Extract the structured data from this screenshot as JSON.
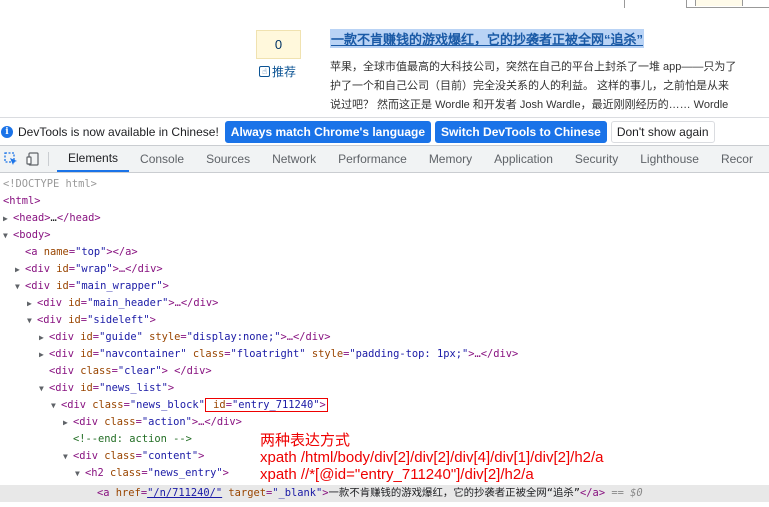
{
  "page": {
    "vote_count": "0",
    "recommend_label": "推荐",
    "news_title": "一款不肯赚钱的游戏爆红，它的抄袭者正被全网“追杀”",
    "summary_lines": [
      "苹果，全球市值最高的大科技公司，突然在自己的平台上封杀了一堆 app——只为了",
      "护了一个和自己公司（目前）完全没关系的人的利益。 这样的事儿，之前怕是从来",
      "说过吧？ 然而这正是 Wordle 和开发者 Josh Wardle，最近刚刚经历的…… Wordle"
    ]
  },
  "infobar": {
    "icon": "info-icon",
    "message": "DevTools is now available in Chinese!",
    "btn_match": "Always match Chrome's language",
    "btn_switch": "Switch DevTools to Chinese",
    "btn_dismiss": "Don't show again"
  },
  "toolbar": {
    "tabs": [
      "Elements",
      "Console",
      "Sources",
      "Network",
      "Performance",
      "Memory",
      "Application",
      "Security",
      "Lighthouse",
      "Recor"
    ],
    "active_tab": "Elements"
  },
  "dom": {
    "l0": "<!DOCTYPE html>",
    "l1_tag": "<html>",
    "l2_open": "<head>",
    "l2_ell": "…",
    "l2_close": "</head>",
    "l3_tag": "<body>",
    "l4_tag": "<a ",
    "l4_attr": "name",
    "l4_val": "\"top\"",
    "l4_end": "></a>",
    "l5_tag": "<div ",
    "l5_attr": "id",
    "l5_val": "\"wrap\"",
    "l5_end": ">…</div>",
    "l6_tag": "<div ",
    "l6_attr": "id",
    "l6_val": "\"main_wrapper\"",
    "l6_end": ">",
    "l7_tag": "<div ",
    "l7_attr": "id",
    "l7_val": "\"main_header\"",
    "l7_end": ">…</div>",
    "l8_tag": "<div ",
    "l8_attr": "id",
    "l8_val": "\"sideleft\"",
    "l8_end": ">",
    "l9_tag": "<div ",
    "l9_attr1": "id",
    "l9_val1": "\"guide\"",
    "l9_attr2": "style",
    "l9_val2": "\"display:none;\"",
    "l9_end": ">…</div>",
    "l10_tag": "<div ",
    "l10_attr1": "id",
    "l10_val1": "\"navcontainer\"",
    "l10_attr2": "class",
    "l10_val2": "\"floatright\"",
    "l10_attr3": "style",
    "l10_val3": "\"padding-top: 1px;\"",
    "l10_end": ">…</div>",
    "l11_tag": "<div ",
    "l11_attr": "class",
    "l11_val": "\"clear\"",
    "l11_end": "> </div>",
    "l12_tag": "<div ",
    "l12_attr": "id",
    "l12_val": "\"news_list\"",
    "l12_end": ">",
    "l13_tag": "<div ",
    "l13_attr1": "class",
    "l13_val1": "\"news_block\"",
    "l13_attr2": "id",
    "l13_val2": "\"entry_711240\"",
    "l13_end": ">",
    "l14_tag": "<div ",
    "l14_attr": "class",
    "l14_val": "\"action\"",
    "l14_end": ">…</div>",
    "l15_cmt": "<!--end: action -->",
    "l16_tag": "<div ",
    "l16_attr": "class",
    "l16_val": "\"content\"",
    "l16_end": ">",
    "l17_tag": "<h2 ",
    "l17_attr": "class",
    "l17_val": "\"news_entry\"",
    "l17_end": ">",
    "l18_tag": "<a ",
    "l18_attr1": "href",
    "l18_val1": "\"/n/711240/\"",
    "l18_attr2": "target",
    "l18_val2": "\"_blank\"",
    "l18_text": "一款不肯赚钱的游戏爆红，它的抄袭者正被全网“追杀”",
    "l18_close": "</a>",
    "l18_eq": " == $0",
    "eq_sign": "=",
    "gt": ">"
  },
  "annotation": {
    "heading": "两种表达方式",
    "xpath1": "xpath /html/body/div[2]/div[2]/div[4]/div[1]/div[2]/h2/a",
    "xpath2": "xpath //*[@id=\"entry_711240\"]/div[2]/h2/a"
  },
  "colors": {
    "accent": "#1a73e8",
    "annotation": "#e00000",
    "tag": "#881280",
    "attr": "#994500",
    "value": "#1a1aa6"
  }
}
